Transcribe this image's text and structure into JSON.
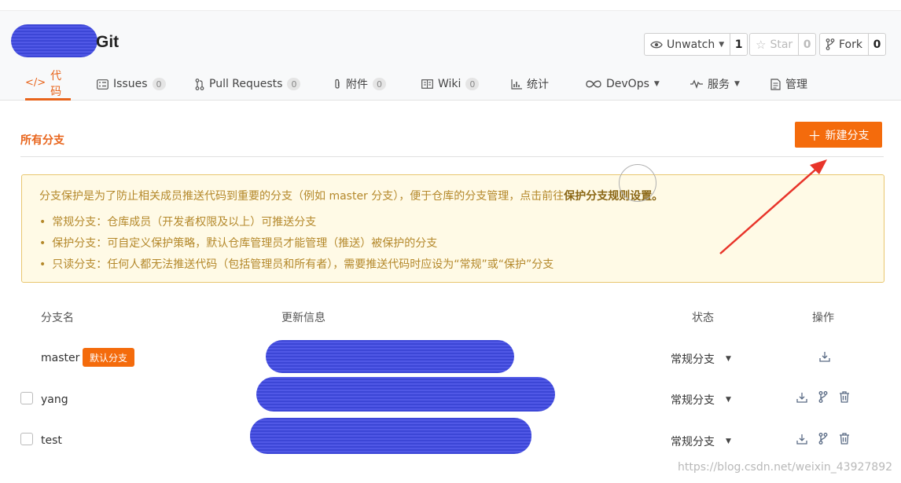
{
  "repo": {
    "title": "Git"
  },
  "header_buttons": {
    "unwatch": {
      "label": "Unwatch",
      "count": "1"
    },
    "star": {
      "label": "Star",
      "count": "0"
    },
    "fork": {
      "label": "Fork",
      "count": "0"
    }
  },
  "nav": {
    "tabs": [
      {
        "label": "代码"
      },
      {
        "label": "Issues",
        "count": "0"
      },
      {
        "label": "Pull Requests",
        "count": "0"
      },
      {
        "label": "附件",
        "count": "0"
      },
      {
        "label": "Wiki",
        "count": "0"
      },
      {
        "label": "统计"
      },
      {
        "label": "DevOps"
      },
      {
        "label": "服务"
      },
      {
        "label": "管理"
      }
    ]
  },
  "section": {
    "title": "所有分支",
    "new_branch_label": "新建分支"
  },
  "notice": {
    "intro": "分支保护是为了防止相关成员推送代码到重要的分支（例如 master 分支），便于仓库的分支管理，点击前往",
    "link": "保护分支规则设置。",
    "items": [
      "常规分支：仓库成员（开发者权限及以上）可推送分支",
      "保护分支：可自定义保护策略，默认仓库管理员才能管理（推送）被保护的分支",
      "只读分支：任何人都无法推送代码（包括管理员和所有者），需要推送代码时应设为“常规”或“保护”分支"
    ]
  },
  "table": {
    "headers": {
      "name": "分支名",
      "update": "更新信息",
      "status": "状态",
      "ops": "操作"
    },
    "default_tag": "默认分支",
    "rows": [
      {
        "name": "master",
        "status": "常规分支"
      },
      {
        "name": "yang",
        "status": "常规分支"
      },
      {
        "name": "test",
        "status": "常规分支"
      }
    ]
  },
  "watermark": "https://blog.csdn.net/weixin_43927892",
  "colors": {
    "accent": "#e8641b",
    "button": "#f46b0c",
    "notice_bg": "#fffae6",
    "notice_text": "#b4882a",
    "redaction": "#3c46d6"
  }
}
